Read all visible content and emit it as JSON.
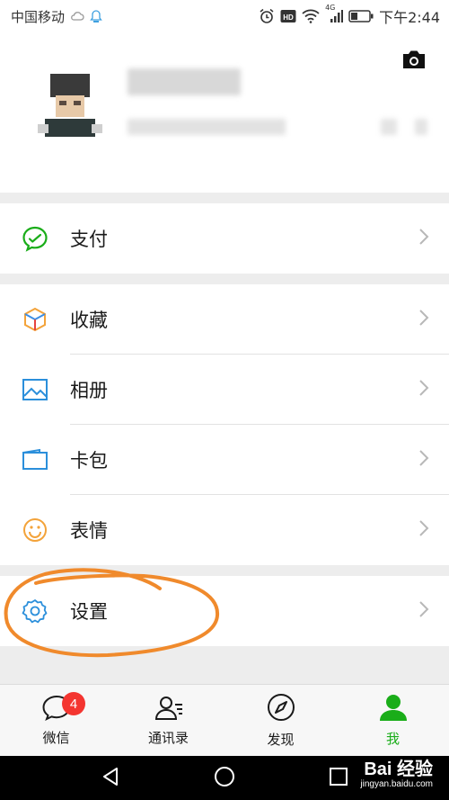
{
  "status_bar": {
    "carrier": "中国移动",
    "network": "4G",
    "time": "下午2:44"
  },
  "menu": {
    "pay": "支付",
    "favorites": "收藏",
    "album": "相册",
    "cards": "卡包",
    "stickers": "表情",
    "settings": "设置"
  },
  "tabbar": {
    "tabs": [
      {
        "label": "微信",
        "badge": "4",
        "icon": "chat-icon"
      },
      {
        "label": "通讯录",
        "icon": "contacts-icon"
      },
      {
        "label": "发现",
        "icon": "compass-icon"
      },
      {
        "label": "我",
        "icon": "person-icon",
        "active": true
      }
    ]
  },
  "watermark": {
    "brand": "Bai 经验",
    "url": "jingyan.baidu.com"
  },
  "colors": {
    "accent_green": "#1aad19",
    "badge_red": "#f43530",
    "annotation_orange": "#f08a2c"
  }
}
